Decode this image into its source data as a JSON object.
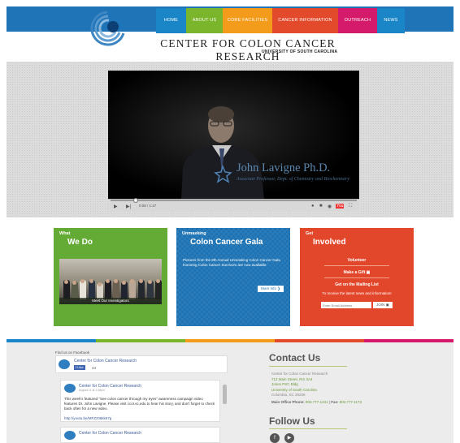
{
  "site": {
    "title": "Center for Colon Cancer Research",
    "subtitle": "UNIVERSITY OF SOUTH CAROLINA"
  },
  "nav": [
    {
      "label": "HOME",
      "color": "#1a86c7"
    },
    {
      "label": "ABOUT US",
      "color": "#7ab52b"
    },
    {
      "label": "CORE FACILITIES",
      "color": "#f39b1b"
    },
    {
      "label": "CANCER INFORMATION",
      "color": "#e24a2b"
    },
    {
      "label": "OUTREACH",
      "color": "#d51a6c"
    },
    {
      "label": "NEWS",
      "color": "#1a86c7"
    }
  ],
  "video": {
    "name": "John Lavigne Ph.D.",
    "caption": "Associate Professor, Dept. of Chemistry and Biochemistry",
    "time": "0:08 / 1:47"
  },
  "cards": {
    "what": {
      "kicker": "What",
      "title": "We Do",
      "photo_caption": "Meet Our Investigators",
      "color": "#64ab36"
    },
    "gala": {
      "kicker": "Unmasking",
      "title": "Colon Cancer Gala",
      "body": "Pictures from the 8th Annual Unmasking Colon Cancer Gala honoring Colon Cancer Survivors are now available.",
      "button": "More Info",
      "color": "#1d73b3"
    },
    "involved": {
      "kicker": "Get",
      "title": "Involved",
      "volunteer": "Volunteer",
      "gift": "Make a Gift",
      "mailing": "Get on the Mailing List",
      "mailing_sub": "To receive the latest news and information!",
      "email_placeholder": "Enter Email Address",
      "join": "JOIN",
      "color": "#e3472b"
    }
  },
  "facebook": {
    "find_label": "Find us on Facebook",
    "page_name": "Center for Colon Cancer Research",
    "like_label": "Like",
    "like_count": "44",
    "post_author": "Center for Colon Cancer Research",
    "post_date": "August 11 at 1:38pm",
    "post_text": "This week's featured \"See colon cancer through my eyes\" awareness campaign video features Dr. John Lavigne. Please visit ccor.sc.edu to hear his story, and don't forget to check back often for a new video.",
    "post_link": "http://youtu.be/MFZz06kk67g",
    "post2_author": "Center for Colon Cancer Research"
  },
  "contact": {
    "title": "Contact Us",
    "lines": [
      "Center for Colon Cancer Research",
      "712 Main Street, Rm 3A4",
      "Jones PSC Bldg",
      "University of South Carolina",
      "Columbia, SC 29208"
    ],
    "phone_label": "Main Office Phone:",
    "phone": "803.777.1231",
    "fax_label": "Fax:",
    "fax": "803.777.1173"
  },
  "follow": {
    "title": "Follow Us",
    "icons": [
      "facebook-icon",
      "youtube-icon"
    ]
  }
}
